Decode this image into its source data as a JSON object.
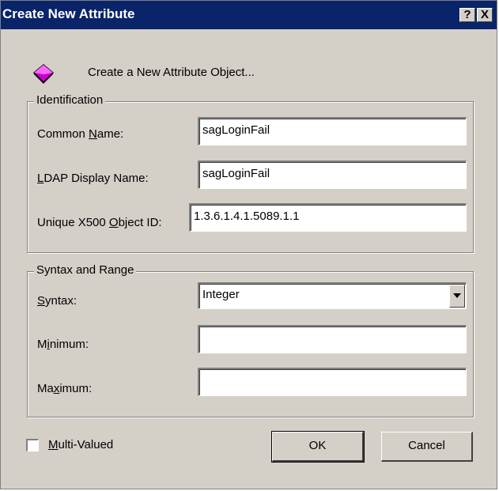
{
  "window": {
    "title": "Create New Attribute",
    "help_button": "?",
    "close_button": "X"
  },
  "header": {
    "text": "Create a New Attribute Object...",
    "icon": "attribute-object-icon",
    "icon_color": "#cc00cc"
  },
  "identification": {
    "legend": "Identification",
    "common_name": {
      "label_pre": "Common ",
      "label_key": "N",
      "label_post": "ame:",
      "value": "sagLoginFail"
    },
    "ldap_display_name": {
      "label_pre": "",
      "label_key": "L",
      "label_post": "DAP Display Name:",
      "value": "sagLoginFail"
    },
    "object_id": {
      "label_pre": "Unique X500 ",
      "label_key": "O",
      "label_post": "bject ID:",
      "value": "1.3.6.1.4.1.5089.1.1"
    }
  },
  "syntax_range": {
    "legend": "Syntax and Range",
    "syntax": {
      "label_pre": "",
      "label_key": "S",
      "label_post": "yntax:",
      "value": "Integer"
    },
    "minimum": {
      "label_pre": "M",
      "label_key": "i",
      "label_post": "nimum:",
      "value": ""
    },
    "maximum": {
      "label_pre": "Ma",
      "label_key": "x",
      "label_post": "imum:",
      "value": ""
    }
  },
  "multi_valued": {
    "label_pre": "",
    "label_key": "M",
    "label_post": "ulti-Valued",
    "checked": false
  },
  "buttons": {
    "ok": "OK",
    "cancel": "Cancel"
  }
}
